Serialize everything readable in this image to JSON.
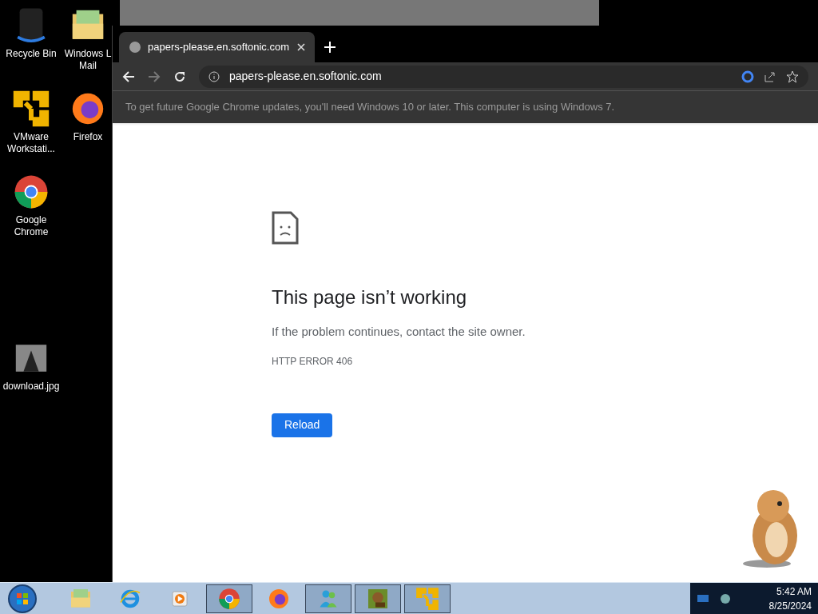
{
  "desktop_icons": [
    {
      "kind": "bin",
      "label": "Recycle Bin"
    },
    {
      "kind": "folder",
      "label": "Windows L Mail"
    },
    {
      "kind": "vmware",
      "label": "VMware Workstati..."
    },
    {
      "kind": "firefox",
      "label": "Firefox"
    },
    {
      "kind": "chrome",
      "label": "Google Chrome"
    },
    {
      "kind": "image",
      "label": "download.jpg"
    }
  ],
  "browser": {
    "tab": {
      "title": "papers-please.en.softonic.com",
      "selected": true
    },
    "address": "papers-please.en.softonic.com",
    "infobar": "To get future Google Chrome updates, you'll need Windows 10 or later. This computer is using Windows 7.",
    "error": {
      "title": "This page isn’t working",
      "message": "If the problem continues, contact the site owner.",
      "code": "HTTP ERROR 406",
      "button": "Reload"
    }
  },
  "taskbar": {
    "items": [
      {
        "kind": "explorer",
        "active": false
      },
      {
        "kind": "ie",
        "active": false
      },
      {
        "kind": "media",
        "active": false
      },
      {
        "kind": "chrome",
        "active": true
      },
      {
        "kind": "firefox",
        "active": false
      },
      {
        "kind": "messenger",
        "active": true
      },
      {
        "kind": "game",
        "active": true
      },
      {
        "kind": "vmware",
        "active": true
      }
    ],
    "time": "5:42 AM",
    "date": "8/25/2024"
  }
}
